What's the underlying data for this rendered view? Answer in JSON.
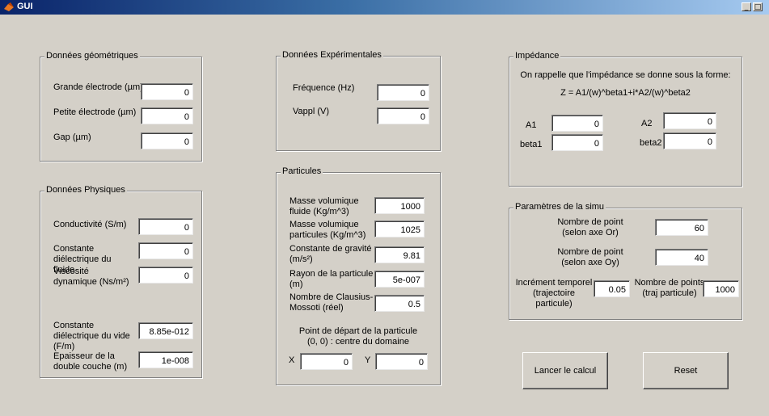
{
  "window": {
    "title": "GUI",
    "min": "_",
    "max": "□"
  },
  "geo": {
    "title": "Données géométriques",
    "grande_label": "Grande électrode (µm)",
    "grande_value": "0",
    "petite_label": "Petite électrode (µm)",
    "petite_value": "0",
    "gap_label": "Gap (µm)",
    "gap_value": "0"
  },
  "phys": {
    "title": "Données Physiques",
    "cond_label": "Conductivité (S/m)",
    "cond_value": "0",
    "cdiel_label": "Constante diélectrique du fluide",
    "cdiel_value": "0",
    "visc_label": "Viscosité dynamique (Ns/m²)",
    "visc_value": "0",
    "cdvide_label": "Constante diélectrique du vide (F/m)",
    "cdvide_value": "8.85e-012",
    "epais_label": "Epaisseur de la double couche (m)",
    "epais_value": "1e-008"
  },
  "exp": {
    "title": "Données Expérimentales",
    "freq_label": "Fréquence (Hz)",
    "freq_value": "0",
    "vappl_label": "Vappl (V)",
    "vappl_value": "0"
  },
  "part": {
    "title": "Particules",
    "mvf_label": "Masse volumique fluide (Kg/m^3)",
    "mvf_value": "1000",
    "mvp_label": "Masse volumique particules (Kg/m^3)",
    "mvp_value": "1025",
    "grav_label": "Constante de gravité (m/s²)",
    "grav_value": "9.81",
    "rayon_label": "Rayon de la particule (m)",
    "rayon_value": "5e-007",
    "claus_label": "Nombre de Clausius-Mossoti (réel)",
    "claus_value": "0.5",
    "depart_line1": "Point de départ de la particule",
    "depart_line2": "(0, 0) : centre du domaine",
    "x_label": "X",
    "x_value": "0",
    "y_label": "Y",
    "y_value": "0"
  },
  "imp": {
    "title": "Impédance",
    "note": "On rappelle que l'impédance se donne sous la forme:",
    "formula": "Z = A1/(w)^beta1+i*A2/(w)^beta2",
    "a1_label": "A1",
    "a1_value": "0",
    "a2_label": "A2",
    "a2_value": "0",
    "beta1_label": "beta1",
    "beta1_value": "0",
    "beta2_label": "beta2",
    "beta2_value": "0"
  },
  "simu": {
    "title": "Paramètres de la simu",
    "nor_label": "Nombre de point (selon axe Or)",
    "nor_value": "60",
    "noy_label": "Nombre de point (selon axe Oy)",
    "noy_value": "40",
    "incr_label": "Incrément temporel (trajectoire particule)",
    "incr_value": "0.05",
    "npts_label": "Nombre de points (traj particule)",
    "npts_value": "1000"
  },
  "buttons": {
    "run": "Lancer le calcul",
    "reset": "Reset"
  }
}
